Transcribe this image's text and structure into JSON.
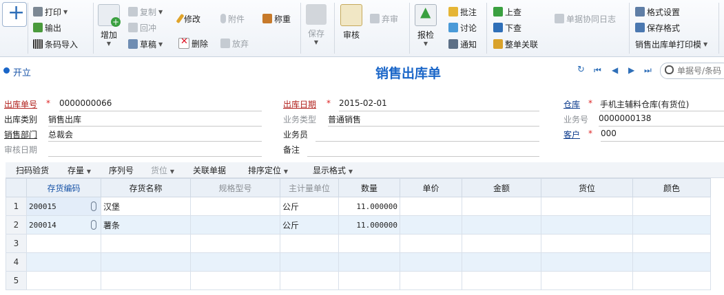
{
  "ribbon": {
    "add_label": "增加",
    "print": "打印",
    "output": "输出",
    "barcode_import": "条码导入",
    "copy": "复制",
    "reverse": "回冲",
    "draft": "草稿",
    "modify": "修改",
    "delete": "删除",
    "attach": "附件",
    "abandon": "放弃",
    "weigh": "称重",
    "save": "保存",
    "audit": "审核",
    "unaudit": "弃审",
    "report_check": "报检",
    "batch_note": "批注",
    "discuss": "讨论",
    "notify": "通知",
    "prev_query": "上查",
    "next_query": "下查",
    "full_link": "整单关联",
    "collab_log": "单据协同日志",
    "format_settings": "格式设置",
    "save_format": "保存格式",
    "print_template": "销售出库单打印模"
  },
  "titlebar": {
    "status": "开立",
    "title": "销售出库单",
    "search_placeholder": "单据号/条码"
  },
  "form": {
    "out_no_label": "出库单号",
    "out_no": "0000000066",
    "out_date_label": "出库日期",
    "out_date": "2015-02-01",
    "warehouse_label": "仓库",
    "warehouse": "手机主辅料仓库(有货位)",
    "out_type_label": "出库类别",
    "out_type": "销售出库",
    "biz_type_label": "业务类型",
    "biz_type": "普通销售",
    "biz_no_label": "业务号",
    "biz_no": "0000000138",
    "dept_label": "销售部门",
    "dept": "总裁会",
    "clerk_label": "业务员",
    "clerk": "",
    "customer_label": "客户",
    "customer": "000",
    "audit_date_label": "审核日期",
    "audit_date": "",
    "remark_label": "备注",
    "remark": ""
  },
  "grid_toolbar": {
    "scan": "扫码验货",
    "stock": "存量",
    "serial": "序列号",
    "location": "货位",
    "related": "关联单据",
    "sort": "排序定位",
    "display": "显示格式"
  },
  "table": {
    "headers": [
      "存货编码",
      "存货名称",
      "规格型号",
      "主计量单位",
      "数量",
      "单价",
      "金额",
      "货位",
      "颜色"
    ],
    "rows": [
      {
        "n": "1",
        "code": "200015",
        "name": "汉堡",
        "spec": "",
        "unit": "公斤",
        "qty": "11.000000",
        "price": "",
        "amount": "",
        "loc": "",
        "color": ""
      },
      {
        "n": "2",
        "code": "200014",
        "name": "薯条",
        "spec": "",
        "unit": "公斤",
        "qty": "11.000000",
        "price": "",
        "amount": "",
        "loc": "",
        "color": ""
      },
      {
        "n": "3",
        "code": "",
        "name": "",
        "spec": "",
        "unit": "",
        "qty": "",
        "price": "",
        "amount": "",
        "loc": "",
        "color": ""
      },
      {
        "n": "4",
        "code": "",
        "name": "",
        "spec": "",
        "unit": "",
        "qty": "",
        "price": "",
        "amount": "",
        "loc": "",
        "color": ""
      },
      {
        "n": "5",
        "code": "",
        "name": "",
        "spec": "",
        "unit": "",
        "qty": "",
        "price": "",
        "amount": "",
        "loc": "",
        "color": ""
      }
    ]
  },
  "colors": {
    "accent": "#1a66c8",
    "required": "#d22222",
    "row_alt": "#e8f2fb"
  }
}
